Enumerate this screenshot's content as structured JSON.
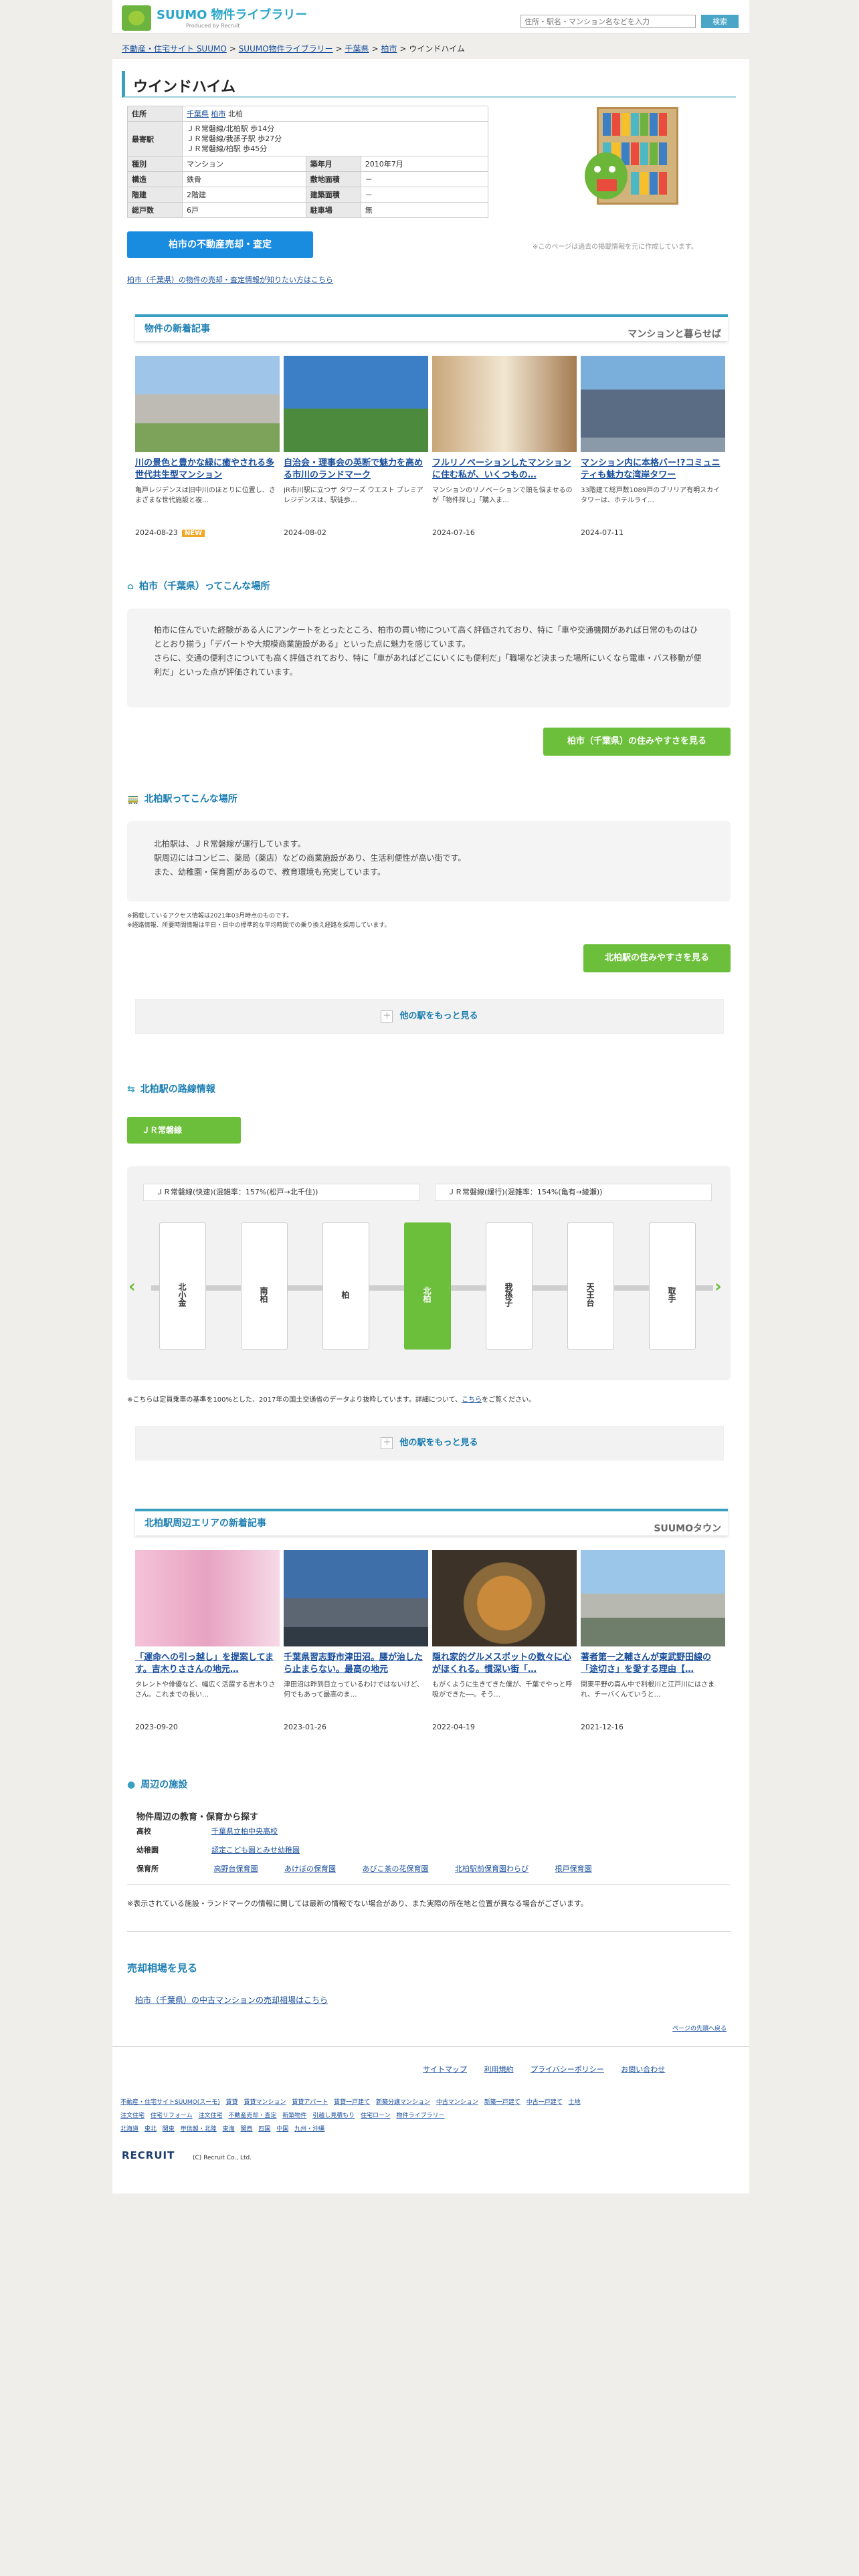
{
  "header": {
    "brand_a": "SUUMO",
    "brand_b": "物件ライブラリー",
    "sub": "Produced by Recruit",
    "search_placeholder": "住所・駅名・マンション名などを入力",
    "search_button": "検索"
  },
  "breadcrumb": [
    "不動産・住宅サイト SUUMO",
    "SUUMO物件ライブラリー",
    "千葉県",
    "柏市",
    "ウインドハイム"
  ],
  "title": "ウインドハイム",
  "property": {
    "address_label": "住所",
    "address_pref": "千葉県",
    "address_city": "柏市",
    "address_rest": "北柏",
    "station_label": "最寄駅",
    "stations": [
      "ＪＲ常磐線/北柏駅 歩14分",
      "ＪＲ常磐線/我孫子駅 歩27分",
      "ＪＲ常磐線/柏駅 歩45分"
    ],
    "type_label": "種別",
    "type": "マンション",
    "built_label": "築年月",
    "built": "2010年7月",
    "structure_label": "構造",
    "structure": "鉄骨",
    "land_label": "敷地面積",
    "land": "－",
    "floors_label": "階建",
    "floors": "2階建",
    "building_label": "建築面積",
    "building": "－",
    "units_label": "総戸数",
    "units": "6戸",
    "parking_label": "駐車場",
    "parking": "無"
  },
  "sell_button": "柏市の不動産売却・査定",
  "note_past": "※このページは過去の掲載情報を元に作成しています。",
  "info_link": "柏市（千葉県）の物件の売却・査定情報が知りたい方はこちら",
  "articles1": {
    "heading": "物件の新着記事",
    "logo": "マンションと暮らせば",
    "items": [
      {
        "title": "川の景色と豊かな緑に癒やされる多世代共生型マンション",
        "desc": "亀戸レジデンスは旧中川のほとりに位置し、さまざまな世代施設と複…",
        "date": "2024-08-23",
        "new": "NEW"
      },
      {
        "title": "自治会・理事会の英断で魅力を高める市川のランドマーク",
        "desc": "JR市川駅に立つザ タワーズ ウエスト プレミアレジデンスは、駅徒歩…",
        "date": "2024-08-02"
      },
      {
        "title": "フルリノベーションしたマンションに住む私が、いくつもの…",
        "desc": "マンションのリノベーションで頭を悩ませるのが「物件探し」「購入ま…",
        "date": "2024-07-16"
      },
      {
        "title": "マンション内に本格バー!?コミュニティも魅力な湾岸タワー",
        "desc": "33階建て総戸数1089戸のブリリア有明スカイタワーは、ホテルライ…",
        "date": "2024-07-11"
      }
    ]
  },
  "city": {
    "heading": "柏市（千葉県）ってこんな場所",
    "text": "柏市に住んでいた経験がある人にアンケートをとったところ、柏市の買い物について高く評価されており、特に「車や交通機関があれば日常のものはひととおり揃う」「デパートや大規模商業施設がある」といった点に魅力を感じています。\nさらに、交通の便利さについても高く評価されており、特に「車があればどこにいくにも便利だ」「職場など決まった場所にいくなら電車・バス移動が便利だ」といった点が評価されています。",
    "button": "柏市（千葉県）の住みやすさを見る"
  },
  "station_area": {
    "heading": "北柏駅ってこんな場所",
    "text": "北柏駅は、ＪＲ常磐線が運行しています。\n駅周辺にはコンビニ、薬局（薬店）などの商業施設があり、生活利便性が高い街です。\nまた、幼稚園・保育園があるので、教育環境も充実しています。",
    "note1": "※掲載しているアクセス情報は2021年03月時点のものです。",
    "note2": "※経路情報、所要時間情報は平日・日中の標準的な平均時間での乗り換え経路を採用しています。",
    "button": "北柏駅の住みやすさを見る",
    "more": "他の駅をもっと見る"
  },
  "route": {
    "heading": "北柏駅の路線情報",
    "tab": "ＪＲ常磐線",
    "dir1": "ＪＲ常磐線(快速)(混雑率：157%(松戸→北千住))",
    "dir2": "ＪＲ常磐線(緩行)(混雑率：154%(亀有→綾瀬))",
    "stations": [
      "北小金",
      "南柏",
      "柏",
      "北柏",
      "我孫子",
      "天王台",
      "取手"
    ],
    "active": "北柏",
    "note_pre": "※こちらは定員乗車の基準を100%とした、2017年の国土交通省のデータより抜粋しています。詳細について、",
    "note_link": "こちら",
    "note_post": "をご覧ください。",
    "more": "他の駅をもっと見る"
  },
  "articles2": {
    "heading": "北柏駅周辺エリアの新着記事",
    "logo": "SUUMOタウン",
    "items": [
      {
        "title": "「運命への引っ越し」を提案してます。吉木りささんの地元…",
        "desc": "タレントや俳優など、幅広く活躍する吉木りささん。これまでの長い…",
        "date": "2023-09-20"
      },
      {
        "title": "千葉県習志野市津田沼。腰が治したら止まらない。最高の地元",
        "desc": "津田沼は昨到目立っているわけではないけど、何でもあって最高のま…",
        "date": "2023-01-26"
      },
      {
        "title": "隠れ家的グルメスポットの数々に心がほくれる。慣深い街「…",
        "desc": "もがくように生きてきた僕が、千葉でやっと呼吸ができた──。そう…",
        "date": "2022-04-19"
      },
      {
        "title": "著者第一之輔さんが東武野田線の「途切さ」を愛する理由【…",
        "desc": "関東平野の真ん中で利根川と江戸川にはさまれ、チーバくんていうと…",
        "date": "2021-12-16"
      }
    ]
  },
  "facilities": {
    "heading": "周辺の施設",
    "sub": "物件周辺の教育・保育から探す",
    "rows": [
      {
        "label": "高校",
        "links": [
          "千葉県立柏中央高校"
        ]
      },
      {
        "label": "幼稚園",
        "links": [
          "認定こども園とみせ幼稚園"
        ]
      },
      {
        "label": "保育所",
        "links": [
          "高野台保育園",
          "あけぼの保育園",
          "あびこ茶の花保育園",
          "北柏駅前保育園わらび",
          "根戸保育園"
        ]
      }
    ],
    "note": "※表示されている施設・ランドマークの情報に関しては最新の情報でない場合があり、また実際の所在地と位置が異なる場合がございます。"
  },
  "price": {
    "heading": "売却相場を見る",
    "link": "柏市（千葉県）の中古マンションの売却相場はこちら"
  },
  "totop": "ページの先頭へ戻る",
  "footer": {
    "links": [
      "サイトマップ",
      "利用規約",
      "プライバシーポリシー",
      "お問い合わせ"
    ],
    "small": [
      "不動産・住宅サイトSUUMO(スーモ)",
      "賃貸",
      "賃貸マンション",
      "賃貸アパート",
      "賃貸一戸建て",
      "新築分譲マンション",
      "中古マンション",
      "新築一戸建て",
      "中古一戸建て",
      "土地",
      "注文住宅",
      "住宅リフォーム",
      "注文住宅",
      "不動産売却・査定",
      "新築物件",
      "引越し見積もり",
      "住宅ローン",
      "物件ライブラリー",
      "北海道",
      "東北",
      "関東",
      "甲信越・北陸",
      "東海",
      "関西",
      "四国",
      "中国",
      "九州・沖縄"
    ],
    "recruit": "RECRUIT",
    "copyright": "(C) Recruit Co., Ltd."
  }
}
